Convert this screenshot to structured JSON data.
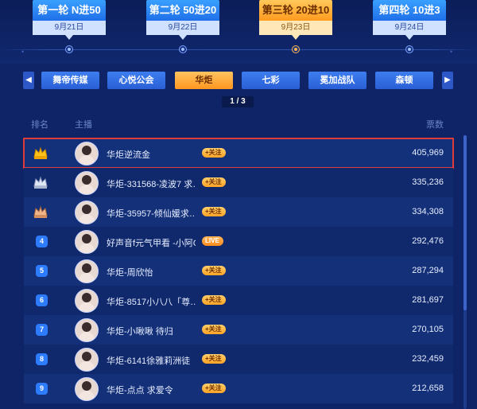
{
  "rounds": [
    {
      "title": "第一轮 N进50",
      "date": "9月21日",
      "active": false
    },
    {
      "title": "第二轮 50进20",
      "date": "9月22日",
      "active": false
    },
    {
      "title": "第三轮 20进10",
      "date": "9月23日",
      "active": true
    },
    {
      "title": "第四轮 10进3",
      "date": "9月24日",
      "active": false
    }
  ],
  "guilds": [
    {
      "label": "舞帝传媒",
      "active": false
    },
    {
      "label": "心悦公会",
      "active": false
    },
    {
      "label": "华炬",
      "active": true
    },
    {
      "label": "七彩",
      "active": false
    },
    {
      "label": "冕加战队",
      "active": false
    },
    {
      "label": "森顿",
      "active": false
    }
  ],
  "pager": "1 / 3",
  "table": {
    "col_rank": "排名",
    "col_anchor": "主播",
    "col_votes": "票数",
    "rows": [
      {
        "rank": "1",
        "name": "华炬逆流金",
        "tag": "+关注",
        "live": false,
        "votes": "405,969",
        "highlight": true
      },
      {
        "rank": "2",
        "name": "华炬-331568-凌波7 求…",
        "tag": "+关注",
        "live": false,
        "votes": "335,236"
      },
      {
        "rank": "3",
        "name": "华炬-35957-倾仙媛求…",
        "tag": "+关注",
        "live": false,
        "votes": "334,308"
      },
      {
        "rank": "4",
        "name": "好声音f元气甲看 -小阿C",
        "tag": "LIVE",
        "live": true,
        "votes": "292,476"
      },
      {
        "rank": "5",
        "name": "华炬-周欣怡",
        "tag": "+关注",
        "live": false,
        "votes": "287,294"
      },
      {
        "rank": "6",
        "name": "华炬-8517小八八「尊…",
        "tag": "+关注",
        "live": false,
        "votes": "281,697"
      },
      {
        "rank": "7",
        "name": "华炬-小啾啾 待归",
        "tag": "+关注",
        "live": false,
        "votes": "270,105"
      },
      {
        "rank": "8",
        "name": "华炬-6141徐雅莉洲徒",
        "tag": "+关注",
        "live": false,
        "votes": "232,459"
      },
      {
        "rank": "9",
        "name": "华炬-点点 求爱令",
        "tag": "+关注",
        "live": false,
        "votes": "212,658"
      }
    ]
  },
  "colors": {
    "background": "#0f2467",
    "accent_orange": "#ff9b1f",
    "accent_blue": "#2e6ee6",
    "highlight_border": "#e23b3b"
  }
}
